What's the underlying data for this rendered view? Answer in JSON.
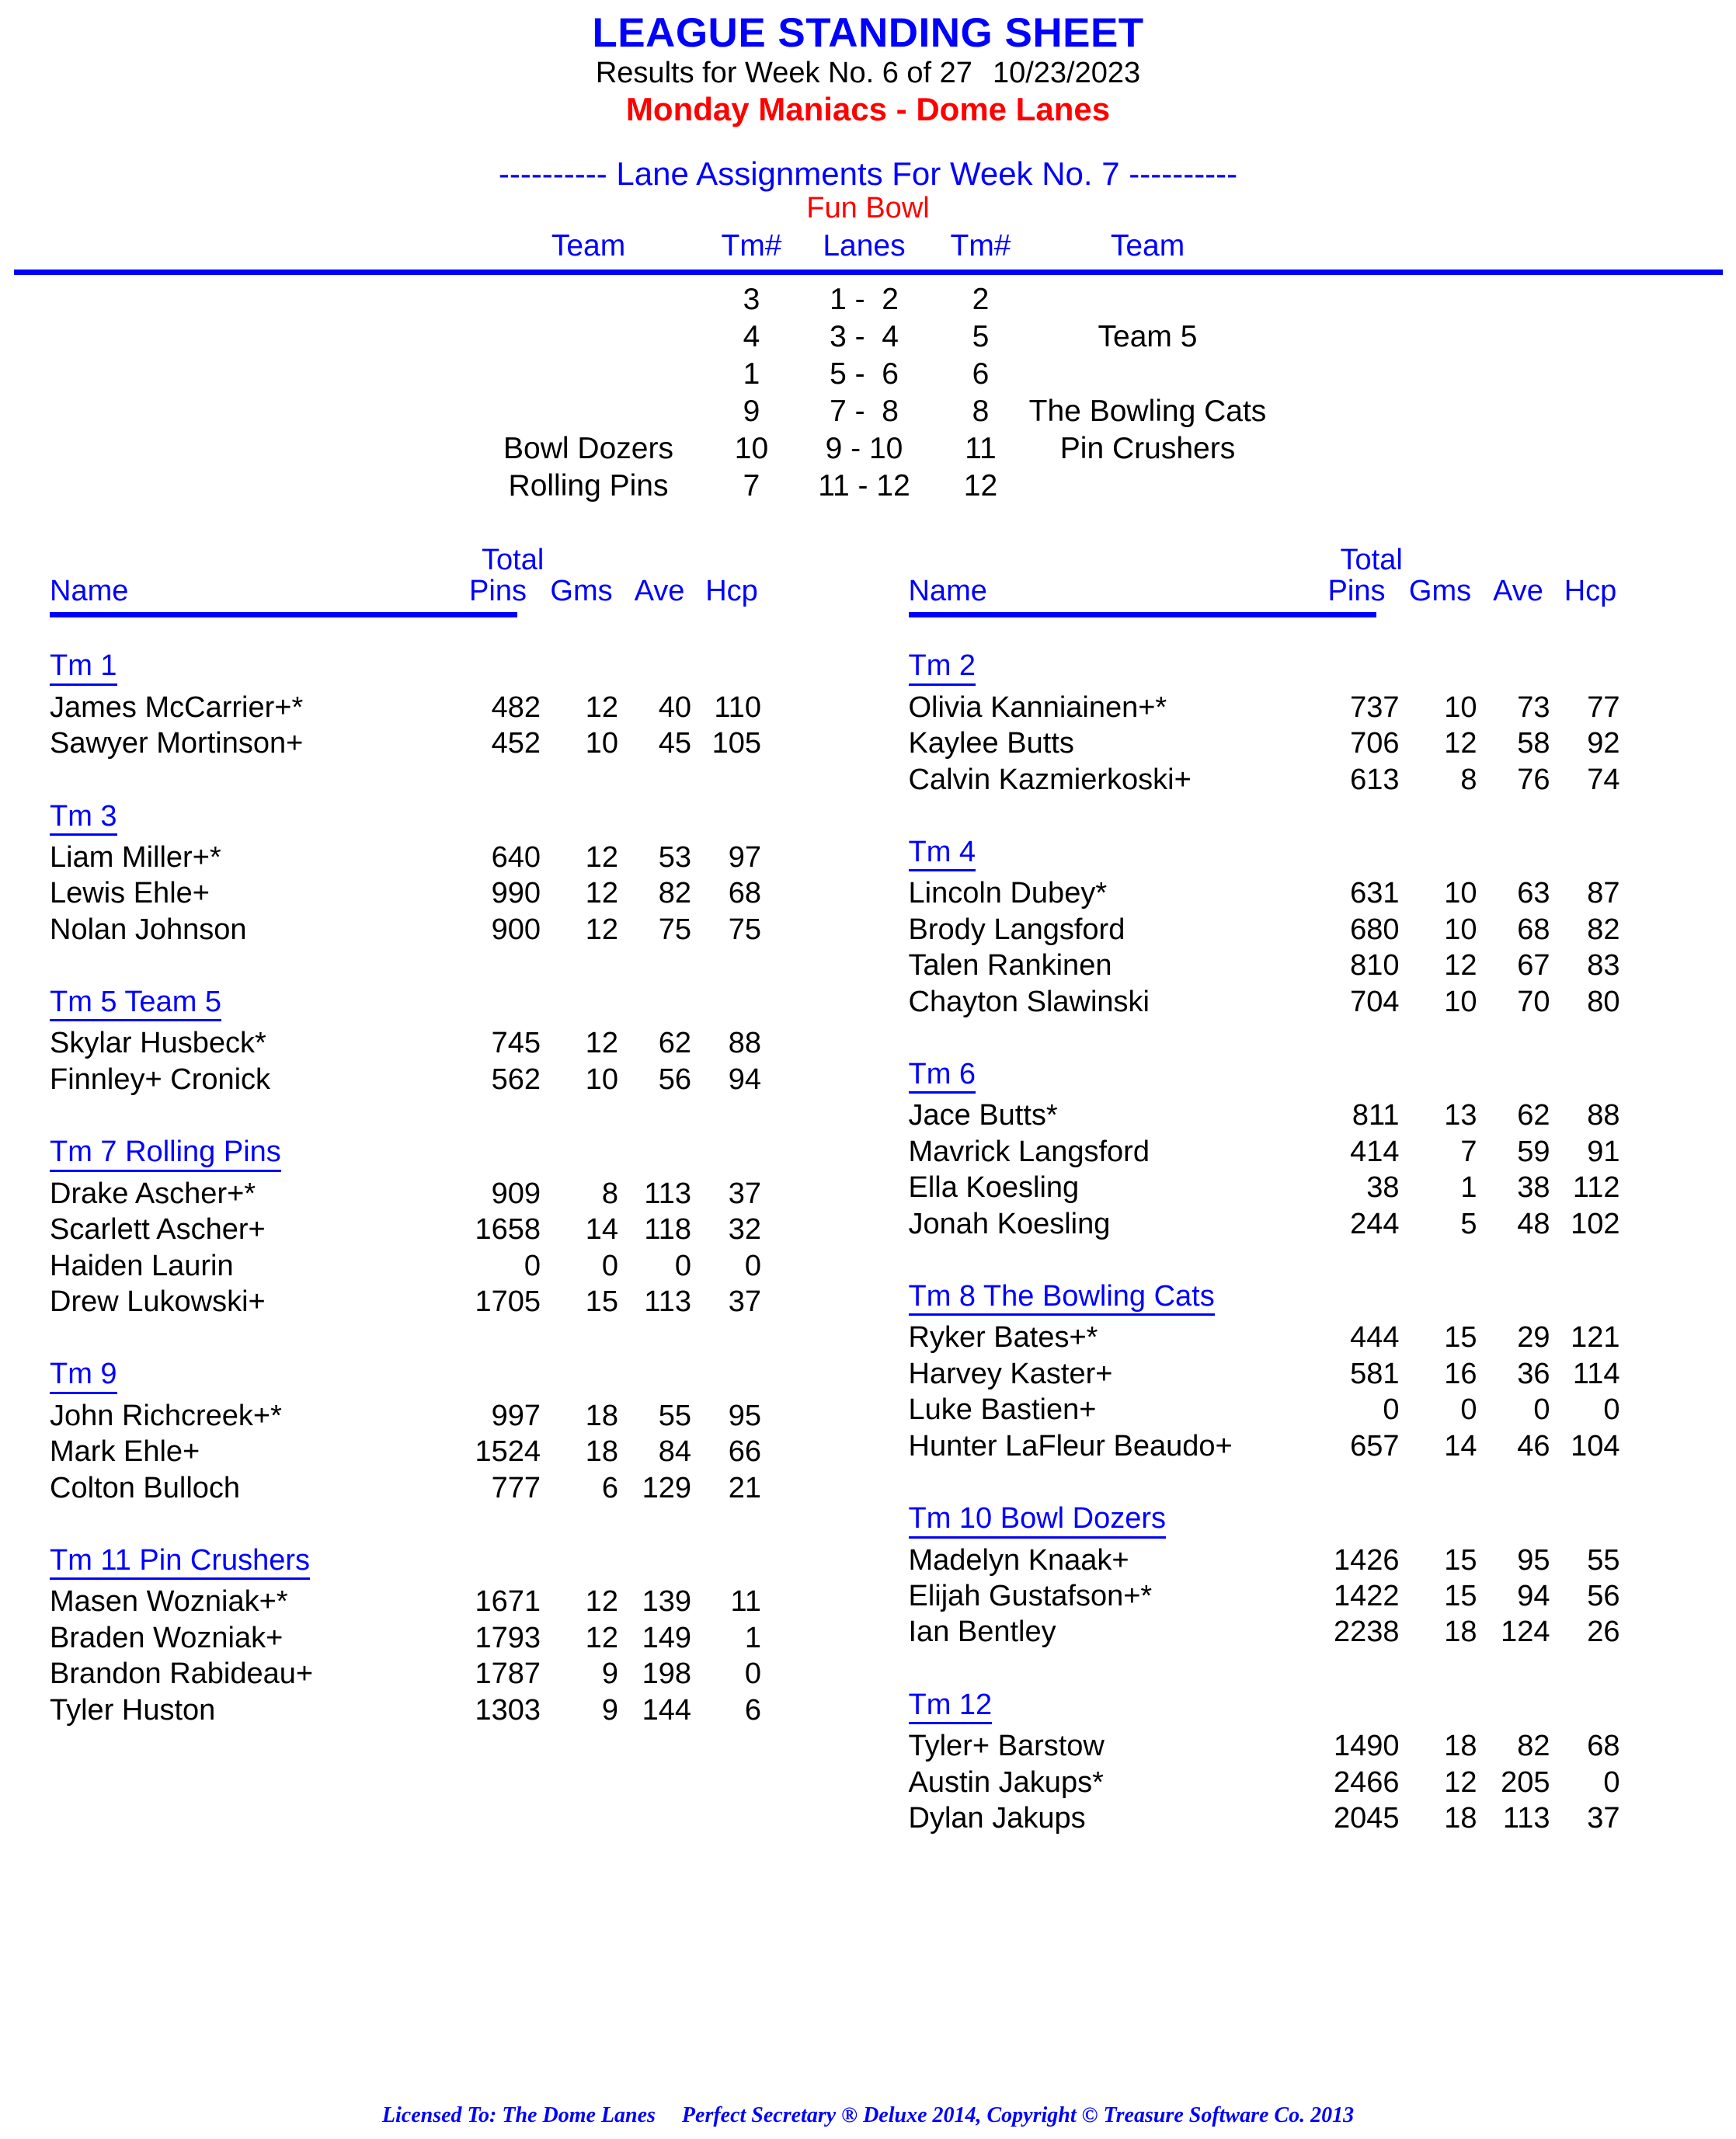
{
  "header": {
    "title": "LEAGUE STANDING SHEET",
    "results_line": "Results for Week No. 6 of 27",
    "date": "10/23/2023",
    "league": "Monday Maniacs - Dome Lanes"
  },
  "lane_assignments": {
    "heading": "---------- Lane Assignments For Week No. 7 ----------",
    "subheading": "Fun Bowl",
    "columns": {
      "team_left": "Team",
      "tm_left": "Tm#",
      "lanes": "Lanes",
      "tm_right": "Tm#",
      "team_right": "Team"
    },
    "rows": [
      {
        "team_left": "",
        "tm_left": "3",
        "lanes": "1 -  2",
        "tm_right": "2",
        "team_right": ""
      },
      {
        "team_left": "",
        "tm_left": "4",
        "lanes": "3 -  4",
        "tm_right": "5",
        "team_right": "Team 5"
      },
      {
        "team_left": "",
        "tm_left": "1",
        "lanes": "5 -  6",
        "tm_right": "6",
        "team_right": ""
      },
      {
        "team_left": "",
        "tm_left": "9",
        "lanes": "7 -  8",
        "tm_right": "8",
        "team_right": "The Bowling Cats"
      },
      {
        "team_left": "Bowl Dozers",
        "tm_left": "10",
        "lanes": "9 - 10",
        "tm_right": "11",
        "team_right": "Pin Crushers"
      },
      {
        "team_left": "Rolling Pins",
        "tm_left": "7",
        "lanes": "11 - 12",
        "tm_right": "12",
        "team_right": ""
      }
    ]
  },
  "roster_headers": {
    "total": "Total",
    "name": "Name",
    "pins": "Pins",
    "gms": "Gms",
    "ave": "Ave",
    "hcp": "Hcp"
  },
  "teams_left": [
    {
      "name": "Tm 1",
      "players": [
        {
          "name": "James McCarrier+*",
          "pins": "482",
          "gms": "12",
          "ave": "40",
          "hcp": "110"
        },
        {
          "name": "Sawyer Mortinson+",
          "pins": "452",
          "gms": "10",
          "ave": "45",
          "hcp": "105"
        }
      ]
    },
    {
      "name": "Tm 3",
      "players": [
        {
          "name": "Liam Miller+*",
          "pins": "640",
          "gms": "12",
          "ave": "53",
          "hcp": "97"
        },
        {
          "name": "Lewis Ehle+",
          "pins": "990",
          "gms": "12",
          "ave": "82",
          "hcp": "68"
        },
        {
          "name": "Nolan Johnson",
          "pins": "900",
          "gms": "12",
          "ave": "75",
          "hcp": "75"
        }
      ]
    },
    {
      "name": "Tm 5 Team 5",
      "players": [
        {
          "name": "Skylar Husbeck*",
          "pins": "745",
          "gms": "12",
          "ave": "62",
          "hcp": "88"
        },
        {
          "name": "Finnley+ Cronick",
          "pins": "562",
          "gms": "10",
          "ave": "56",
          "hcp": "94"
        }
      ]
    },
    {
      "name": "Tm 7 Rolling Pins",
      "players": [
        {
          "name": "Drake Ascher+*",
          "pins": "909",
          "gms": "8",
          "ave": "113",
          "hcp": "37"
        },
        {
          "name": "Scarlett Ascher+",
          "pins": "1658",
          "gms": "14",
          "ave": "118",
          "hcp": "32"
        },
        {
          "name": "Haiden Laurin",
          "pins": "0",
          "gms": "0",
          "ave": "0",
          "hcp": "0"
        },
        {
          "name": "Drew Lukowski+",
          "pins": "1705",
          "gms": "15",
          "ave": "113",
          "hcp": "37"
        }
      ]
    },
    {
      "name": "Tm 9",
      "players": [
        {
          "name": "John Richcreek+*",
          "pins": "997",
          "gms": "18",
          "ave": "55",
          "hcp": "95"
        },
        {
          "name": "Mark Ehle+",
          "pins": "1524",
          "gms": "18",
          "ave": "84",
          "hcp": "66"
        },
        {
          "name": "Colton Bulloch",
          "pins": "777",
          "gms": "6",
          "ave": "129",
          "hcp": "21"
        }
      ]
    },
    {
      "name": "Tm 11 Pin Crushers",
      "players": [
        {
          "name": "Masen Wozniak+*",
          "pins": "1671",
          "gms": "12",
          "ave": "139",
          "hcp": "11"
        },
        {
          "name": "Braden Wozniak+",
          "pins": "1793",
          "gms": "12",
          "ave": "149",
          "hcp": "1"
        },
        {
          "name": "Brandon Rabideau+",
          "pins": "1787",
          "gms": "9",
          "ave": "198",
          "hcp": "0"
        },
        {
          "name": "Tyler Huston",
          "pins": "1303",
          "gms": "9",
          "ave": "144",
          "hcp": "6"
        }
      ]
    }
  ],
  "teams_right": [
    {
      "name": "Tm 2",
      "players": [
        {
          "name": "Olivia Kanniainen+*",
          "pins": "737",
          "gms": "10",
          "ave": "73",
          "hcp": "77"
        },
        {
          "name": "Kaylee Butts",
          "pins": "706",
          "gms": "12",
          "ave": "58",
          "hcp": "92"
        },
        {
          "name": "Calvin Kazmierkoski+",
          "pins": "613",
          "gms": "8",
          "ave": "76",
          "hcp": "74"
        }
      ]
    },
    {
      "name": "Tm 4",
      "players": [
        {
          "name": "Lincoln Dubey*",
          "pins": "631",
          "gms": "10",
          "ave": "63",
          "hcp": "87"
        },
        {
          "name": "Brody Langsford",
          "pins": "680",
          "gms": "10",
          "ave": "68",
          "hcp": "82"
        },
        {
          "name": "Talen Rankinen",
          "pins": "810",
          "gms": "12",
          "ave": "67",
          "hcp": "83"
        },
        {
          "name": "Chayton Slawinski",
          "pins": "704",
          "gms": "10",
          "ave": "70",
          "hcp": "80"
        }
      ]
    },
    {
      "name": "Tm 6",
      "players": [
        {
          "name": "Jace Butts*",
          "pins": "811",
          "gms": "13",
          "ave": "62",
          "hcp": "88"
        },
        {
          "name": "Mavrick Langsford",
          "pins": "414",
          "gms": "7",
          "ave": "59",
          "hcp": "91"
        },
        {
          "name": "Ella Koesling",
          "pins": "38",
          "gms": "1",
          "ave": "38",
          "hcp": "112"
        },
        {
          "name": "Jonah Koesling",
          "pins": "244",
          "gms": "5",
          "ave": "48",
          "hcp": "102"
        }
      ]
    },
    {
      "name": "Tm 8 The Bowling Cats",
      "players": [
        {
          "name": "Ryker Bates+*",
          "pins": "444",
          "gms": "15",
          "ave": "29",
          "hcp": "121"
        },
        {
          "name": "Harvey Kaster+",
          "pins": "581",
          "gms": "16",
          "ave": "36",
          "hcp": "114"
        },
        {
          "name": "Luke Bastien+",
          "pins": "0",
          "gms": "0",
          "ave": "0",
          "hcp": "0"
        },
        {
          "name": "Hunter LaFleur Beaudo+",
          "pins": "657",
          "gms": "14",
          "ave": "46",
          "hcp": "104"
        }
      ]
    },
    {
      "name": "Tm 10 Bowl Dozers",
      "players": [
        {
          "name": "Madelyn Knaak+",
          "pins": "1426",
          "gms": "15",
          "ave": "95",
          "hcp": "55"
        },
        {
          "name": "Elijah Gustafson+*",
          "pins": "1422",
          "gms": "15",
          "ave": "94",
          "hcp": "56"
        },
        {
          "name": "Ian Bentley",
          "pins": "2238",
          "gms": "18",
          "ave": "124",
          "hcp": "26"
        }
      ]
    },
    {
      "name": "Tm 12",
      "players": [
        {
          "name": "Tyler+ Barstow",
          "pins": "1490",
          "gms": "18",
          "ave": "82",
          "hcp": "68"
        },
        {
          "name": "Austin Jakups*",
          "pins": "2466",
          "gms": "12",
          "ave": "205",
          "hcp": "0"
        },
        {
          "name": "Dylan Jakups",
          "pins": "2045",
          "gms": "18",
          "ave": "113",
          "hcp": "37"
        }
      ]
    }
  ],
  "footer": {
    "licensed_to": "Licensed To: The Dome Lanes",
    "software": "Perfect Secretary ® Deluxe  2014, Copyright © Treasure Software Co. 2013"
  },
  "colors": {
    "accent_blue": "#0000ff",
    "accent_red": "#ff0000",
    "text": "#000000"
  }
}
